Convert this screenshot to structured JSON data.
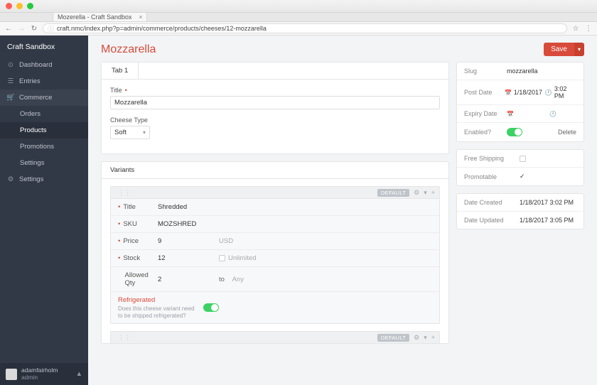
{
  "chrome": {
    "tab_title": "Mozerella - Craft Sandbox",
    "url": "craft.nmc/index.php?p=admin/commerce/products/cheeses/12-mozzarella"
  },
  "sidebar": {
    "brand": "Craft Sandbox",
    "items": [
      {
        "label": "Dashboard"
      },
      {
        "label": "Entries"
      },
      {
        "label": "Commerce"
      }
    ],
    "commerce_sub": [
      {
        "label": "Orders"
      },
      {
        "label": "Products"
      },
      {
        "label": "Promotions"
      },
      {
        "label": "Settings"
      }
    ],
    "settings_label": "Settings",
    "user": {
      "name": "adamfairholm",
      "role": "admin"
    }
  },
  "page": {
    "title": "Mozzarella",
    "save_label": "Save",
    "tabs": [
      {
        "label": "Tab 1"
      }
    ],
    "fields": {
      "title_label": "Title",
      "title_value": "Mozzarella",
      "cheese_type_label": "Cheese Type",
      "cheese_type_value": "Soft"
    },
    "variants_label": "Variants",
    "default_badge": "DEFAULT",
    "variant": {
      "rows": [
        {
          "label": "Title",
          "value": "Shredded",
          "req": true
        },
        {
          "label": "SKU",
          "value": "MOZSHRED",
          "req": true
        },
        {
          "label": "Price",
          "value": "9",
          "req": true,
          "extra": "USD"
        },
        {
          "label": "Stock",
          "value": "12",
          "req": true,
          "extra_chk": true,
          "extra": "Unlimited"
        },
        {
          "label": "Allowed Qty",
          "value": "2",
          "req": false,
          "extra_to": "to",
          "extra": "Any"
        }
      ],
      "refrig_title": "Refrigerated",
      "refrig_desc": "Does this cheese variant need to be shipped refrigerated?"
    }
  },
  "meta": {
    "slug_label": "Slug",
    "slug_value": "mozzarella",
    "post_date_label": "Post Date",
    "post_date_value": "1/18/2017",
    "post_time_value": "3:02 PM",
    "expiry_date_label": "Expiry Date",
    "enabled_label": "Enabled?",
    "delete_label": "Delete",
    "free_ship_label": "Free Shipping",
    "promotable_label": "Promotable",
    "created_label": "Date Created",
    "created_value": "1/18/2017 3:02 PM",
    "updated_label": "Date Updated",
    "updated_value": "1/18/2017 3:05 PM"
  }
}
